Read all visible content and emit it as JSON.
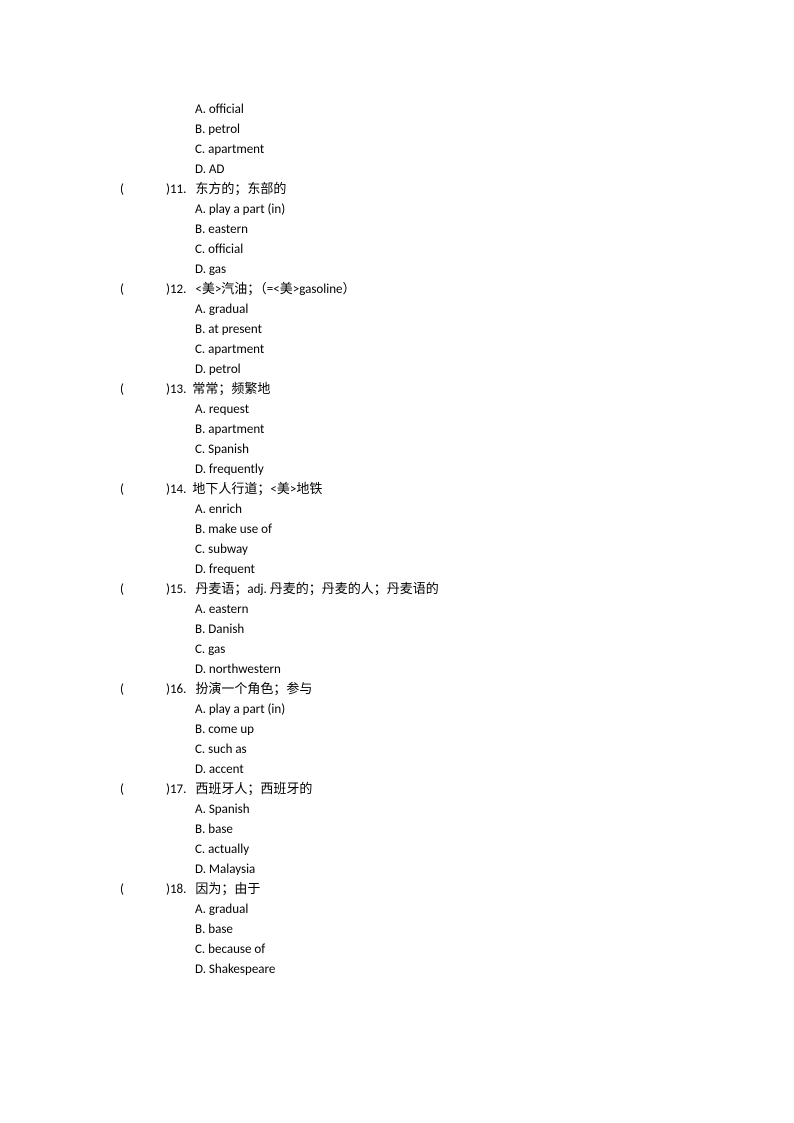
{
  "initial_options": [
    "A. official",
    "B. petrol",
    "C. apartment",
    "D. AD"
  ],
  "questions": [
    {
      "num": ")11.",
      "prompt": "  东方的；东部的",
      "options": [
        "A. play a part (in)",
        "B. eastern",
        "C. official",
        "D. gas"
      ]
    },
    {
      "num": ")12.",
      "prompt": " <美>汽油；（=<美>gasoline）",
      "options": [
        "A. gradual",
        "B. at present",
        "C. apartment",
        "D. petrol"
      ]
    },
    {
      "num": ")13.",
      "prompt": "常常；频繁地",
      "options": [
        "A. request",
        "B. apartment",
        "C. Spanish",
        "D. frequently"
      ]
    },
    {
      "num": ")14.",
      "prompt": "地下人行道；<美>地铁",
      "options": [
        "A. enrich",
        "B. make use of",
        "C. subway",
        "D. frequent"
      ]
    },
    {
      "num": ")15.",
      "prompt": " 丹麦语；adj. 丹麦的；丹麦的人；丹麦语的",
      "options": [
        "A. eastern",
        "B. Danish",
        "C. gas",
        "D. northwestern"
      ]
    },
    {
      "num": ")16.",
      "prompt": "  扮演一个角色；参与",
      "options": [
        "A. play a part (in)",
        "B. come up",
        "C. such as",
        "D. accent"
      ]
    },
    {
      "num": ")17.",
      "prompt": " 西班牙人；西班牙的",
      "options": [
        "A. Spanish",
        "B. base",
        "C. actually",
        "D. Malaysia"
      ]
    },
    {
      "num": ")18.",
      "prompt": " 因为；由于",
      "options": [
        "A. gradual",
        "B. base",
        "C. because of",
        "D. Shakespeare"
      ]
    }
  ]
}
